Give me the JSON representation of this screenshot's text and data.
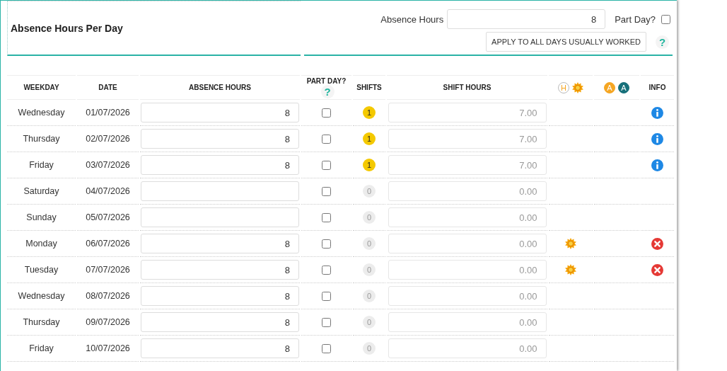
{
  "panel": {
    "title": "Absence Hours Per Day",
    "absence_hours_label": "Absence Hours",
    "absence_hours_value": "8",
    "part_day_label": "Part Day?",
    "part_day_checked": false,
    "apply_button": "APPLY TO ALL DAYS USUALLY WORKED",
    "help": "?"
  },
  "table": {
    "columns": [
      {
        "kind": "text",
        "label": "WEEKDAY"
      },
      {
        "kind": "text",
        "label": "DATE"
      },
      {
        "kind": "text",
        "label": "ABSENCE HOURS"
      },
      {
        "kind": "help",
        "label": "PART DAY?",
        "help": "?"
      },
      {
        "kind": "text",
        "label": "SHIFTS"
      },
      {
        "kind": "text",
        "label": "SHIFT HOURS"
      },
      {
        "kind": "holiday",
        "badges": [
          {
            "letter": "H",
            "color": "#f5a623",
            "filled": false
          }
        ]
      },
      {
        "kind": "badges",
        "badges": [
          {
            "letter": "A",
            "color": "#f5a623",
            "filled": true
          },
          {
            "letter": "A",
            "color": "#17707a",
            "filled": true
          }
        ]
      },
      {
        "kind": "text",
        "label": "INFO"
      }
    ],
    "rows": [
      {
        "weekday": "Wednesday",
        "date": "01/07/2026",
        "absence_hours": "8",
        "part_day": false,
        "shifts": "1",
        "has_shifts": true,
        "shift_hours": "7.00",
        "holiday": false,
        "has_info": true,
        "has_error": false
      },
      {
        "weekday": "Thursday",
        "date": "02/07/2026",
        "absence_hours": "8",
        "part_day": false,
        "shifts": "1",
        "has_shifts": true,
        "shift_hours": "7.00",
        "holiday": false,
        "has_info": true,
        "has_error": false
      },
      {
        "weekday": "Friday",
        "date": "03/07/2026",
        "absence_hours": "8",
        "part_day": false,
        "shifts": "1",
        "has_shifts": true,
        "shift_hours": "7.00",
        "holiday": false,
        "has_info": true,
        "has_error": false
      },
      {
        "weekday": "Saturday",
        "date": "04/07/2026",
        "absence_hours": "",
        "part_day": false,
        "shifts": "0",
        "has_shifts": false,
        "shift_hours": "0.00",
        "holiday": false,
        "has_info": false,
        "has_error": false
      },
      {
        "weekday": "Sunday",
        "date": "05/07/2026",
        "absence_hours": "",
        "part_day": false,
        "shifts": "0",
        "has_shifts": false,
        "shift_hours": "0.00",
        "holiday": false,
        "has_info": false,
        "has_error": false
      },
      {
        "weekday": "Monday",
        "date": "06/07/2026",
        "absence_hours": "8",
        "part_day": false,
        "shifts": "0",
        "has_shifts": false,
        "shift_hours": "0.00",
        "holiday": true,
        "has_info": false,
        "has_error": true
      },
      {
        "weekday": "Tuesday",
        "date": "07/07/2026",
        "absence_hours": "8",
        "part_day": false,
        "shifts": "0",
        "has_shifts": false,
        "shift_hours": "0.00",
        "holiday": true,
        "has_info": false,
        "has_error": true
      },
      {
        "weekday": "Wednesday",
        "date": "08/07/2026",
        "absence_hours": "8",
        "part_day": false,
        "shifts": "0",
        "has_shifts": false,
        "shift_hours": "0.00",
        "holiday": false,
        "has_info": false,
        "has_error": false
      },
      {
        "weekday": "Thursday",
        "date": "09/07/2026",
        "absence_hours": "8",
        "part_day": false,
        "shifts": "0",
        "has_shifts": false,
        "shift_hours": "0.00",
        "holiday": false,
        "has_info": false,
        "has_error": false
      },
      {
        "weekday": "Friday",
        "date": "10/07/2026",
        "absence_hours": "8",
        "part_day": false,
        "shifts": "0",
        "has_shifts": false,
        "shift_hours": "0.00",
        "holiday": false,
        "has_info": false,
        "has_error": false
      }
    ]
  }
}
